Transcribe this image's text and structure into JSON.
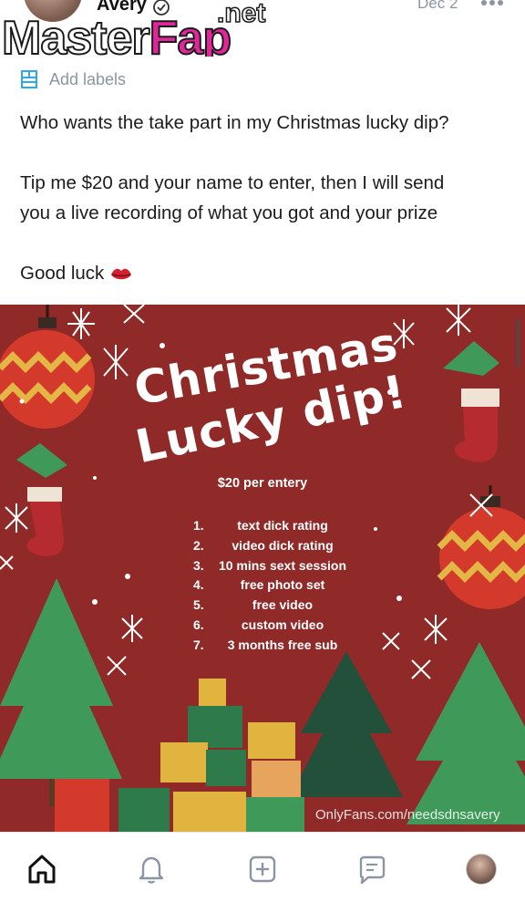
{
  "header": {
    "author_name": "Avery",
    "date": "Dec 2",
    "watermark_main": "Master",
    "watermark_accent": "Fap",
    "watermark_suffix": ".net"
  },
  "labels": {
    "text": "Add labels"
  },
  "post": {
    "line1": "Who wants the take part in my Christmas lucky dip?",
    "line2a": "Tip me $20 and your name to enter, then I will send",
    "line2b": "you a live recording of what you got and your prize",
    "line3": "Good luck"
  },
  "flyer": {
    "title_line1": "Christmas",
    "title_line2": "Lucky dip!",
    "price": "$20 per entery",
    "prizes": [
      {
        "num": "1.",
        "text": "text dick rating"
      },
      {
        "num": "2.",
        "text": "video dick rating"
      },
      {
        "num": "3.",
        "text": "10 mins sext session"
      },
      {
        "num": "4.",
        "text": "free photo set"
      },
      {
        "num": "5.",
        "text": "free video"
      },
      {
        "num": "6.",
        "text": "custom video"
      },
      {
        "num": "7.",
        "text": "3 months free sub"
      }
    ],
    "site_watermark": "OnlyFans.com/needsdnsavery",
    "colors": {
      "background": "#8f2a28",
      "tree_green": "#3f9a5a",
      "ornament_gold": "#e1b440",
      "stocking_red": "#b52b2f"
    }
  },
  "nav": {
    "items": [
      "home-icon",
      "bell-icon",
      "plus-square-icon",
      "chat-icon",
      "profile-avatar"
    ]
  }
}
